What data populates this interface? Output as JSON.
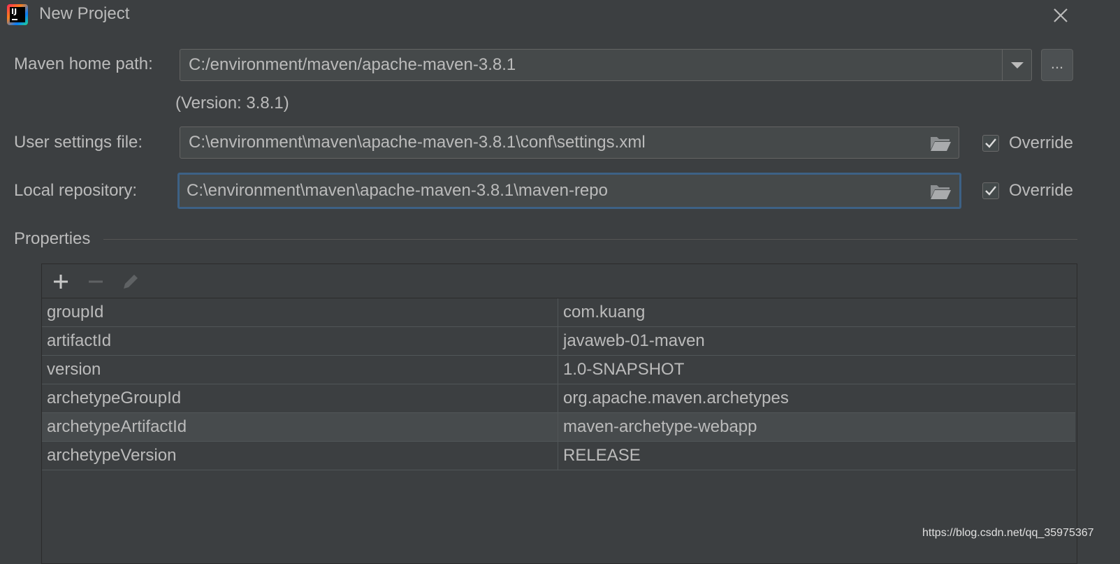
{
  "window": {
    "title": "New Project",
    "app_icon": "intellij-idea-icon",
    "app_icon_text": "IJ",
    "close_icon": "close-icon"
  },
  "maven_home": {
    "label": "Maven home path:",
    "value": "C:/environment/maven/apache-maven-3.8.1",
    "version_text": "(Version: 3.8.1)",
    "browse_label": "..."
  },
  "user_settings": {
    "label": "User settings file:",
    "value": "C:\\environment\\maven\\apache-maven-3.8.1\\conf\\settings.xml",
    "override_label": "Override",
    "override_checked": true
  },
  "local_repo": {
    "label": "Local repository:",
    "value": "C:\\environment\\maven\\apache-maven-3.8.1\\maven-repo",
    "override_label": "Override",
    "override_checked": true
  },
  "properties": {
    "title": "Properties",
    "toolbar": [
      "add-icon",
      "remove-icon",
      "edit-icon"
    ],
    "rows": [
      {
        "key": "groupId",
        "value": "com.kuang"
      },
      {
        "key": "artifactId",
        "value": "javaweb-01-maven"
      },
      {
        "key": "version",
        "value": "1.0-SNAPSHOT"
      },
      {
        "key": "archetypeGroupId",
        "value": "org.apache.maven.archetypes"
      },
      {
        "key": "archetypeArtifactId",
        "value": "maven-archetype-webapp"
      },
      {
        "key": "archetypeVersion",
        "value": "RELEASE"
      }
    ],
    "selected_row": 4
  },
  "watermark": "https://blog.csdn.net/qq_35975367",
  "colors": {
    "background": "#3c3f41",
    "field_bg": "#45494a",
    "focus_border": "#3d6185",
    "text": "#bbbbbb"
  }
}
